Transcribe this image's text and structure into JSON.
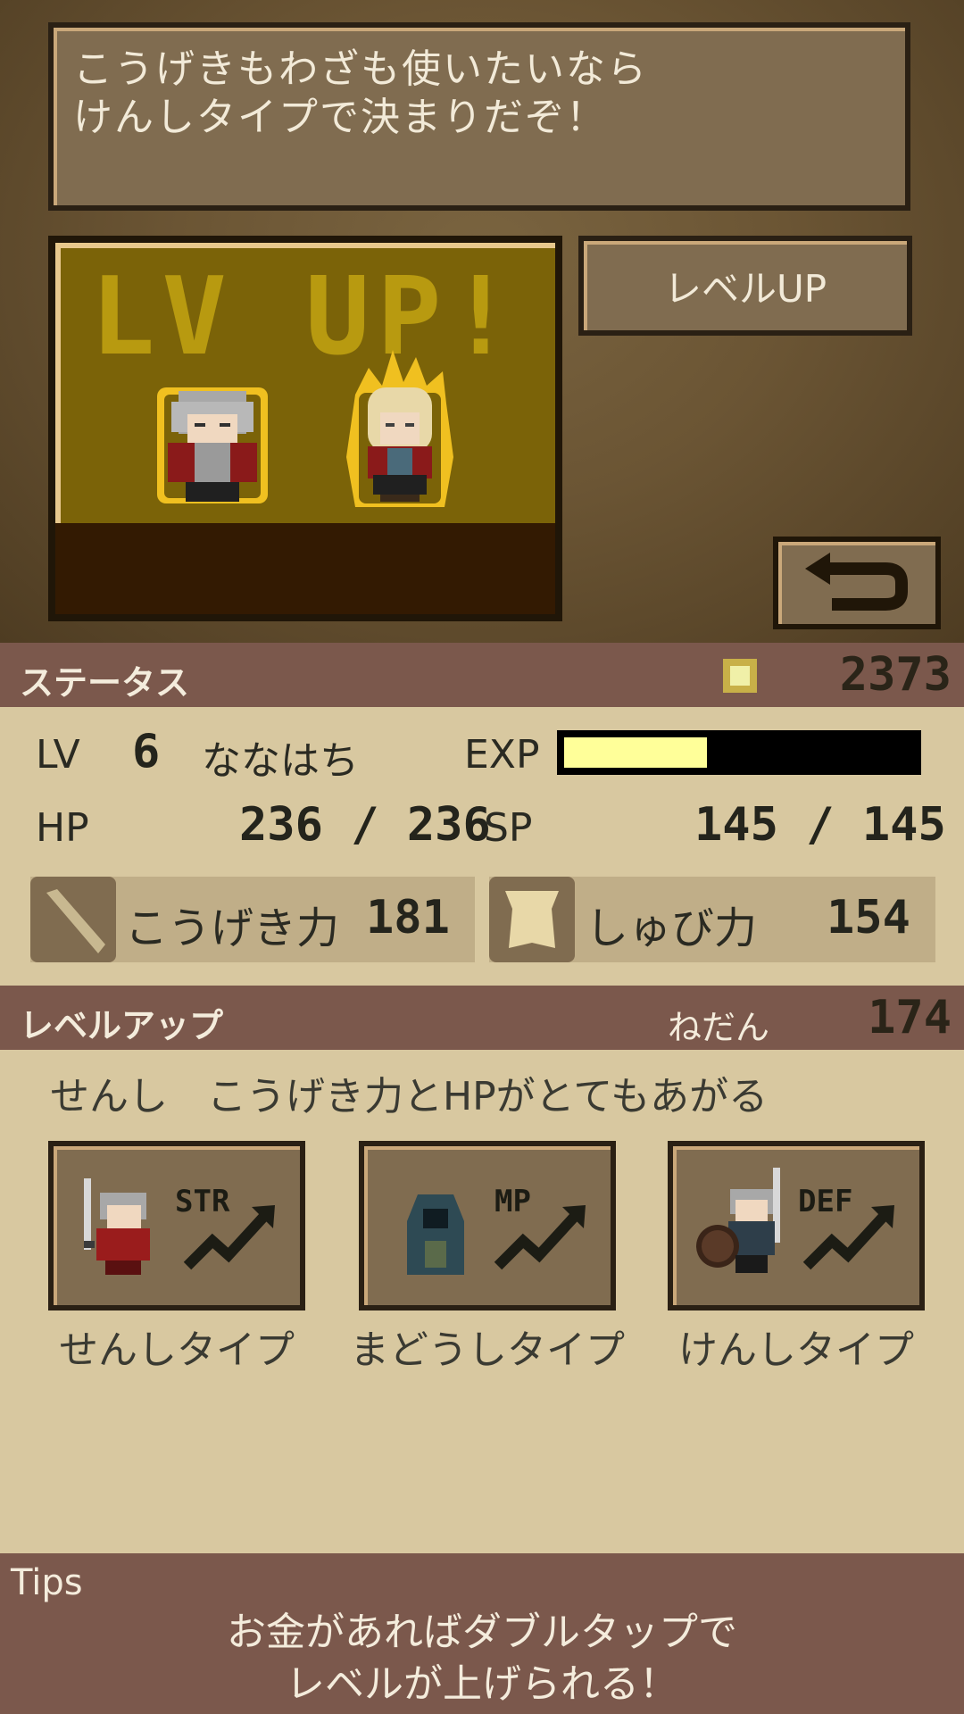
{
  "message": {
    "line1": "こうげきもわざも使いたいなら",
    "line2": "けんしタイプで決まりだぞ！"
  },
  "scene": {
    "banner": "LV UP!"
  },
  "buttons": {
    "level_up": "レベルUP",
    "back_icon": "return-arrow-icon"
  },
  "status": {
    "title": "ステータス",
    "coins": "2373",
    "coin_icon": "coin-icon",
    "lv_label": "LV",
    "lv_value": "6",
    "name": "ななはち",
    "exp_label": "EXP",
    "exp_fraction": 0.4,
    "hp_label": "HP",
    "hp_value": "236 / 236",
    "sp_label": "SP",
    "sp_value": "145 / 145",
    "attack_label": "こうげき力",
    "attack_value": "181",
    "defense_label": "しゅび力",
    "defense_value": "154"
  },
  "levelup": {
    "title": "レベルアップ",
    "price_label": "ねだん",
    "price_value": "174",
    "description": "せんし　こうげき力とHPがとてもあがる",
    "choices": [
      {
        "tag": "STR",
        "label": "せんしタイプ"
      },
      {
        "tag": "MP",
        "label": "まどうしタイプ"
      },
      {
        "tag": "DEF",
        "label": "けんしタイプ"
      }
    ]
  },
  "tips": {
    "title": "Tips",
    "line1": "お金があればダブルタップで",
    "line2": "レベルが上げられる！"
  },
  "colors": {
    "band": "#7b584c",
    "panel": "#d8c8a0",
    "exp_fill": "#ffff99"
  }
}
